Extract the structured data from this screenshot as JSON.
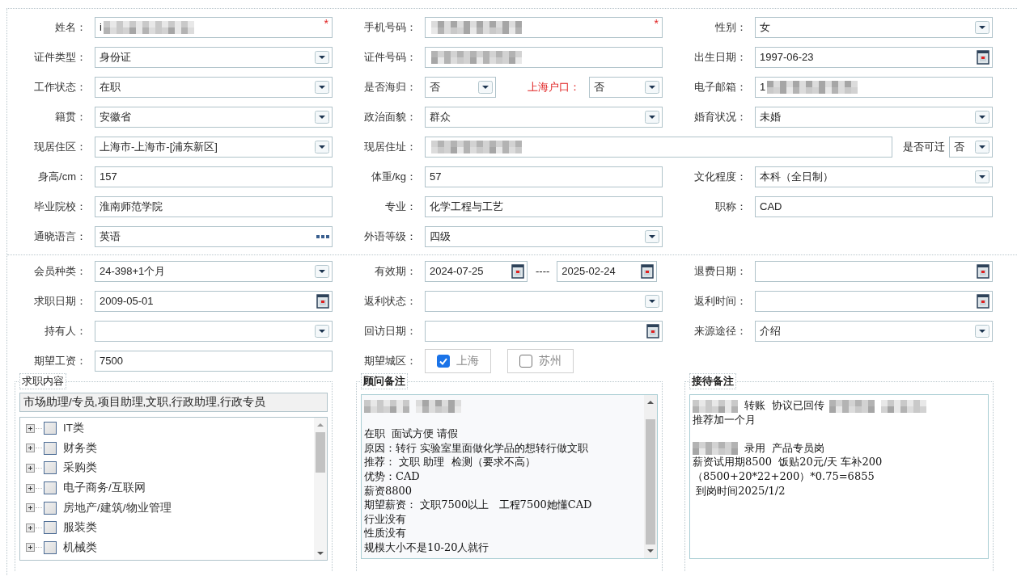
{
  "sections": [
    {
      "rows": [
        {
          "cells": [
            {
              "label": "姓名：",
              "field": {
                "kind": "text",
                "value": "i",
                "redacted": true,
                "mark": "*"
              }
            },
            {
              "label": "手机号码：",
              "field": {
                "kind": "text",
                "redacted": true,
                "mark": "*"
              }
            },
            {
              "label": "性别：",
              "field": {
                "kind": "select",
                "value": "女"
              }
            }
          ]
        },
        {
          "cells": [
            {
              "label": "证件类型：",
              "field": {
                "kind": "select",
                "value": "身份证"
              }
            },
            {
              "label": "证件号码：",
              "field": {
                "kind": "text",
                "redacted": true
              }
            },
            {
              "label": "出生日期：",
              "field": {
                "kind": "date",
                "value": "1997-06-23"
              }
            }
          ]
        },
        {
          "cells": [
            {
              "label": "工作状态：",
              "field": {
                "kind": "select",
                "value": "在职"
              }
            },
            {
              "label": "是否海归：",
              "field": {
                "kind": "select",
                "value": "否"
              },
              "extra": {
                "label": "上海户口：",
                "warn": true,
                "field": {
                  "kind": "select",
                  "value": "否"
                }
              }
            },
            {
              "label": "电子邮箱：",
              "field": {
                "kind": "text",
                "value": "1",
                "redacted": true
              }
            }
          ]
        },
        {
          "cells": [
            {
              "label": "籍贯：",
              "field": {
                "kind": "select",
                "value": "安徽省"
              }
            },
            {
              "label": "政治面貌：",
              "field": {
                "kind": "select",
                "value": "群众"
              }
            },
            {
              "label": "婚育状况：",
              "field": {
                "kind": "select",
                "value": "未婚"
              }
            }
          ]
        },
        {
          "cells": [
            {
              "label": "现居住区：",
              "field": {
                "kind": "select",
                "value": "上海市-上海市-[浦东新区]"
              }
            },
            {
              "label": "现居住址：",
              "span": true,
              "field": {
                "kind": "text",
                "redacted": true
              },
              "extra": {
                "label": "是否可迁",
                "warn": false,
                "field": {
                  "kind": "select",
                  "value": "否"
                }
              }
            }
          ]
        },
        {
          "cells": [
            {
              "label": "身高/cm：",
              "field": {
                "kind": "text",
                "value": "157"
              }
            },
            {
              "label": "体重/kg：",
              "field": {
                "kind": "text",
                "value": "57"
              }
            },
            {
              "label": "文化程度：",
              "field": {
                "kind": "select",
                "value": "本科（全日制）"
              }
            }
          ]
        },
        {
          "cells": [
            {
              "label": "毕业院校：",
              "field": {
                "kind": "text",
                "value": "淮南师范学院"
              }
            },
            {
              "label": "专业：",
              "field": {
                "kind": "text",
                "value": "化学工程与工艺"
              }
            },
            {
              "label": "职称：",
              "field": {
                "kind": "text",
                "value": "CAD"
              }
            }
          ]
        },
        {
          "cells": [
            {
              "label": "通晓语言：",
              "field": {
                "kind": "picker",
                "value": "英语"
              }
            },
            {
              "label": "外语等级：",
              "field": {
                "kind": "select",
                "value": "四级"
              }
            }
          ]
        }
      ]
    },
    {
      "rows": [
        {
          "cells": [
            {
              "label": "会员种类：",
              "field": {
                "kind": "select",
                "value": "24-398+1个月"
              }
            },
            {
              "label": "有效期：",
              "field": {
                "kind": "range",
                "from": "2024-07-25",
                "separator": "----",
                "to": "2025-02-24"
              }
            },
            {
              "label": "退费日期：",
              "field": {
                "kind": "date"
              }
            }
          ]
        },
        {
          "cells": [
            {
              "label": "求职日期：",
              "field": {
                "kind": "date",
                "value": "2009-05-01"
              }
            },
            {
              "label": "返利状态：",
              "field": {
                "kind": "select"
              }
            },
            {
              "label": "返利时间：",
              "field": {
                "kind": "date"
              }
            }
          ]
        },
        {
          "cells": [
            {
              "label": "持有人：",
              "field": {
                "kind": "select"
              }
            },
            {
              "label": "回访日期：",
              "field": {
                "kind": "date"
              }
            },
            {
              "label": "来源途径：",
              "field": {
                "kind": "select",
                "value": "介绍"
              }
            }
          ]
        },
        {
          "cells": [
            {
              "label": "期望工资：",
              "field": {
                "kind": "text",
                "value": "7500"
              }
            },
            {
              "label": "期望城区：",
              "field": {
                "kind": "checks",
                "options": [
                  {
                    "label": "上海",
                    "checked": true
                  },
                  {
                    "label": "苏州",
                    "checked": false
                  }
                ]
              }
            }
          ]
        }
      ]
    }
  ],
  "job_panel": {
    "legend": "求职内容",
    "summary": "市场助理/专员,项目助理,文职,行政助理,行政专员",
    "tree": [
      {
        "label": "IT类",
        "checked": false,
        "expanded": false
      },
      {
        "label": "财务类",
        "checked": false,
        "expanded": false
      },
      {
        "label": "采购类",
        "checked": false,
        "expanded": false
      },
      {
        "label": "电子商务/互联网",
        "checked": false,
        "expanded": false
      },
      {
        "label": "房地产/建筑/物业管理",
        "checked": false,
        "expanded": false
      },
      {
        "label": "服装类",
        "checked": false,
        "expanded": false
      },
      {
        "label": "机械类",
        "checked": false,
        "expanded": false
      }
    ]
  },
  "notes": [
    {
      "legend": "顾问备注",
      "scroll": true,
      "lines": [
        {
          "parts": [
            {
              "kind": "blur"
            },
            {
              "kind": "blur"
            }
          ]
        },
        {
          "kind": "blank"
        },
        {
          "parts": [
            {
              "kind": "text",
              "text": "在职  面试方便 请假"
            }
          ]
        },
        {
          "parts": [
            {
              "kind": "text",
              "text": "原因：转行 实验室里面做化学品的想转行做文职"
            }
          ]
        },
        {
          "parts": [
            {
              "kind": "text",
              "text": "推荐： 文职 助理  检测（要求不高）"
            }
          ]
        },
        {
          "parts": [
            {
              "kind": "text",
              "text": "优势：CAD"
            }
          ]
        },
        {
          "parts": [
            {
              "kind": "text",
              "text": "薪资8800"
            }
          ]
        },
        {
          "parts": [
            {
              "kind": "text",
              "text": "期望薪资： 文职7500以上   工程7500她懂CAD"
            }
          ]
        },
        {
          "parts": [
            {
              "kind": "text",
              "text": "行业没有"
            }
          ]
        },
        {
          "parts": [
            {
              "kind": "text",
              "text": "性质没有"
            }
          ]
        },
        {
          "parts": [
            {
              "kind": "text",
              "text": "规模大小不是10-20人就行"
            }
          ]
        }
      ]
    },
    {
      "legend": "接待备注",
      "scroll": false,
      "lines": [
        {
          "parts": [
            {
              "kind": "blur"
            },
            {
              "kind": "text",
              "text": "转账  协议已回传"
            },
            {
              "kind": "blur"
            },
            {
              "kind": "blur"
            },
            {
              "kind": "text",
              "text": "推荐加一个月"
            }
          ]
        },
        {
          "kind": "blank"
        },
        {
          "parts": [
            {
              "kind": "blur"
            },
            {
              "kind": "text",
              "text": "录用  产品专员岗"
            }
          ]
        },
        {
          "parts": [
            {
              "kind": "text",
              "text": "薪资试用期8500  饭贴20元/天 车补200"
            }
          ]
        },
        {
          "parts": [
            {
              "kind": "text",
              "text": "（8500+20*22+200）*0.75=6855"
            }
          ]
        },
        {
          "parts": [
            {
              "kind": "text",
              "text": " 到岗时间2025/1/2"
            }
          ]
        }
      ]
    }
  ]
}
